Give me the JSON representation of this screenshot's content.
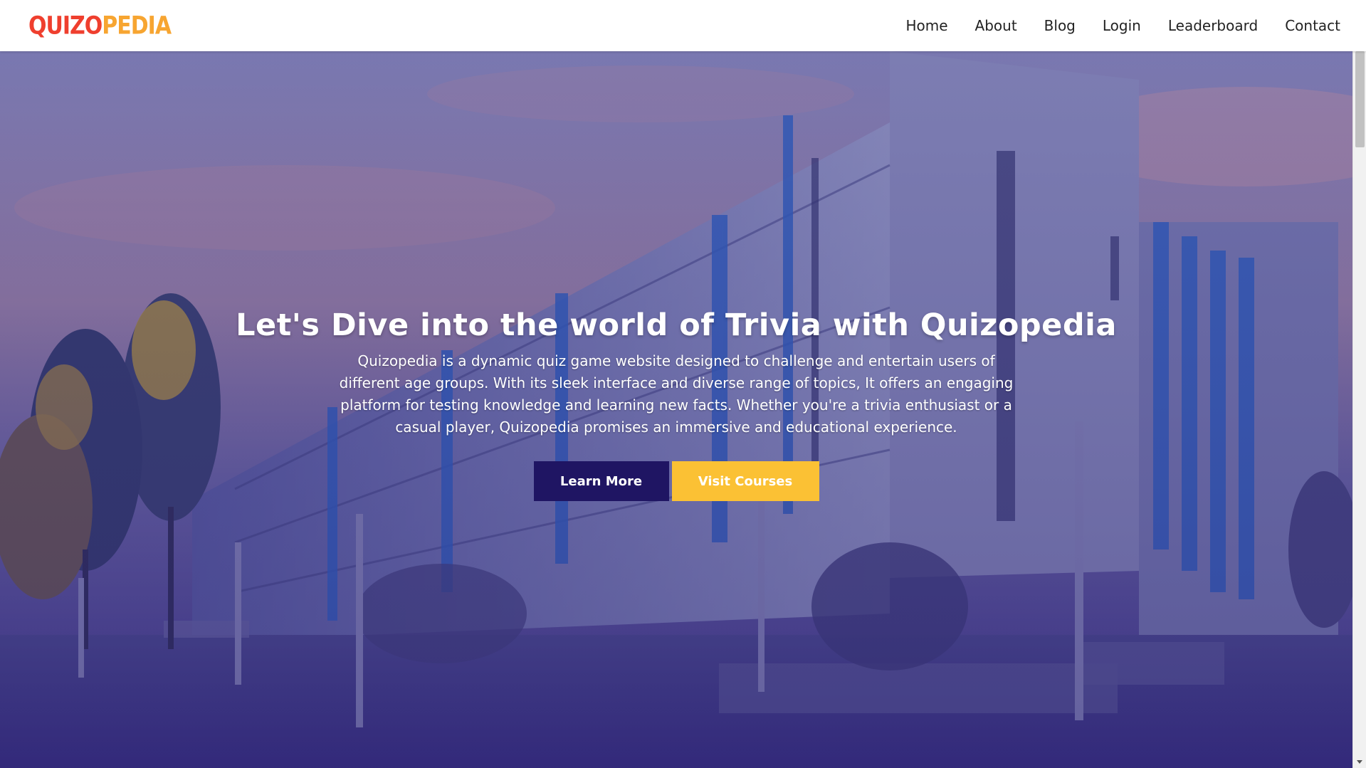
{
  "brand": {
    "logo_text": "QUIZOPEDIA"
  },
  "nav": {
    "items": [
      {
        "label": "Home"
      },
      {
        "label": "About"
      },
      {
        "label": "Blog"
      },
      {
        "label": "Login"
      },
      {
        "label": "Leaderboard"
      },
      {
        "label": "Contact"
      }
    ]
  },
  "hero": {
    "title": "Let's Dive into the world of Trivia with Quizopedia",
    "description_lines": [
      "Quizopedia is a dynamic quiz game website designed to challenge and entertain users of",
      "different age groups. With its sleek interface and diverse range of topics, It offers an engaging",
      "platform for testing knowledge and learning new facts. Whether you're a trivia enthusiast or a",
      "casual player, Quizopedia promises an immersive and educational experience."
    ],
    "buttons": {
      "learn_more": "Learn More",
      "visit_courses": "Visit Courses"
    }
  },
  "colors": {
    "logo_red": "#ef3f2e",
    "logo_orange": "#f7a531",
    "learn_more_bg": "#1f1563",
    "visit_courses_bg": "#fbc134",
    "hero_overlay": "#3a2f83"
  },
  "icons": {
    "scroll_down": "chevron-down-icon"
  }
}
